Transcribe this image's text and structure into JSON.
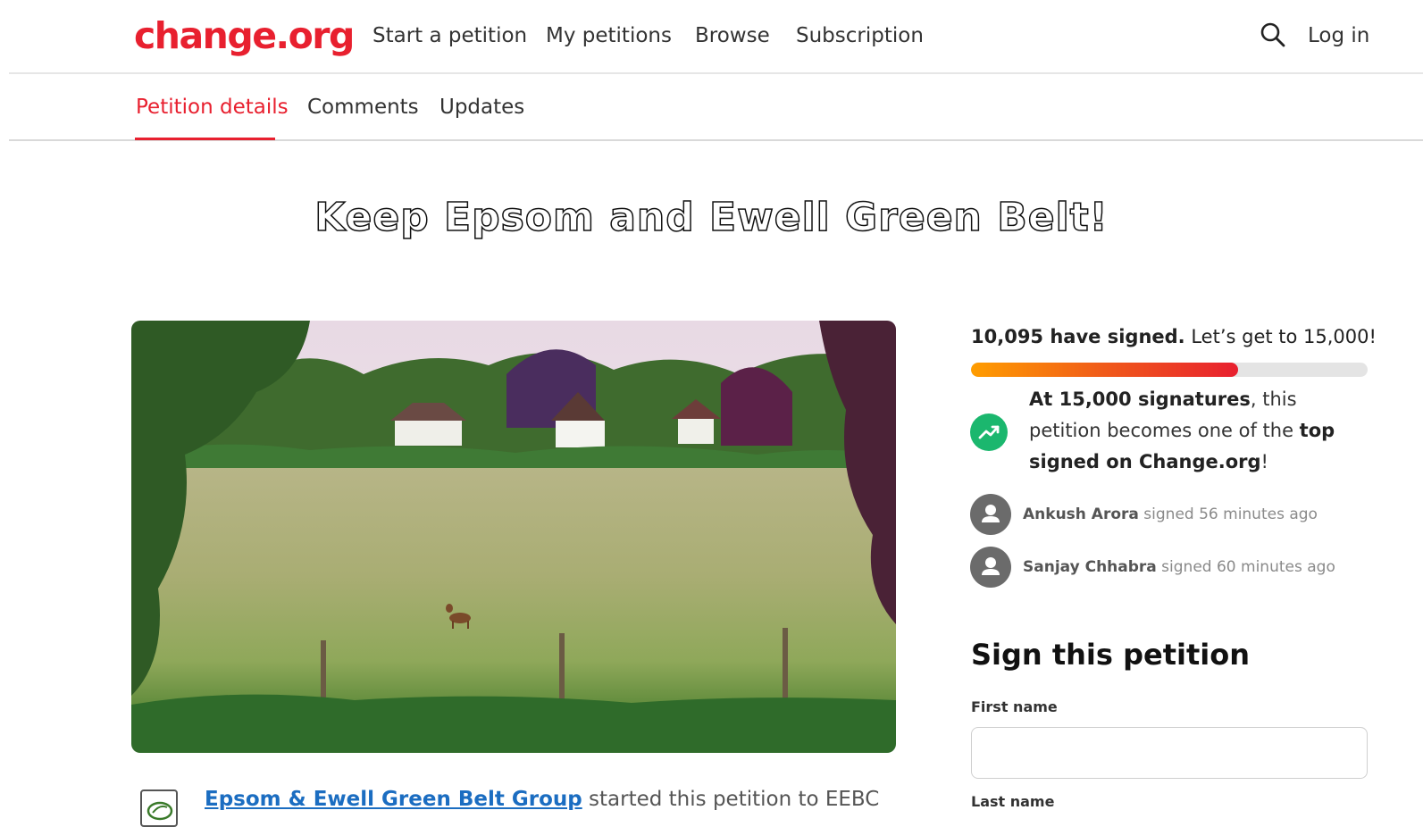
{
  "header": {
    "logo": "change.org",
    "nav": [
      "Start a petition",
      "My petitions",
      "Browse",
      "Subscription"
    ],
    "login": "Log in",
    "search_icon": "search-icon"
  },
  "tabs": {
    "items": [
      "Petition details",
      "Comments",
      "Updates"
    ],
    "active": "Petition details"
  },
  "petition": {
    "title": "Keep Epsom and Ewell Green Belt!",
    "author_name": "Epsom & Ewell Green Belt Group",
    "author_suffix": " started this petition to EEBC"
  },
  "progress": {
    "signed_bold": "10,095 have signed.",
    "goal_text": " Let’s get to 15,000!",
    "fraction": 0.673,
    "colors": {
      "start": "#ff9d00",
      "end": "#e8202f",
      "track": "#e4e4e4"
    }
  },
  "milestone": {
    "part1": "At 15,000 signatures",
    "part2": ", this petition becomes one of the ",
    "part3": "top signed on Change.org",
    "part4": "!",
    "icon": "trending-up-icon"
  },
  "recent_signers": [
    {
      "name": "Ankush Arora",
      "text": " signed 56 minutes ago"
    },
    {
      "name": "Sanjay Chhabra",
      "text": " signed 60 minutes ago"
    }
  ],
  "sign_form": {
    "title": "Sign this petition",
    "first_name_label": "First name",
    "first_name_value": "",
    "last_name_label": "Last name"
  },
  "colors": {
    "brand": "#e8202f",
    "link": "#1b6dc1",
    "success": "#1bb76e"
  }
}
